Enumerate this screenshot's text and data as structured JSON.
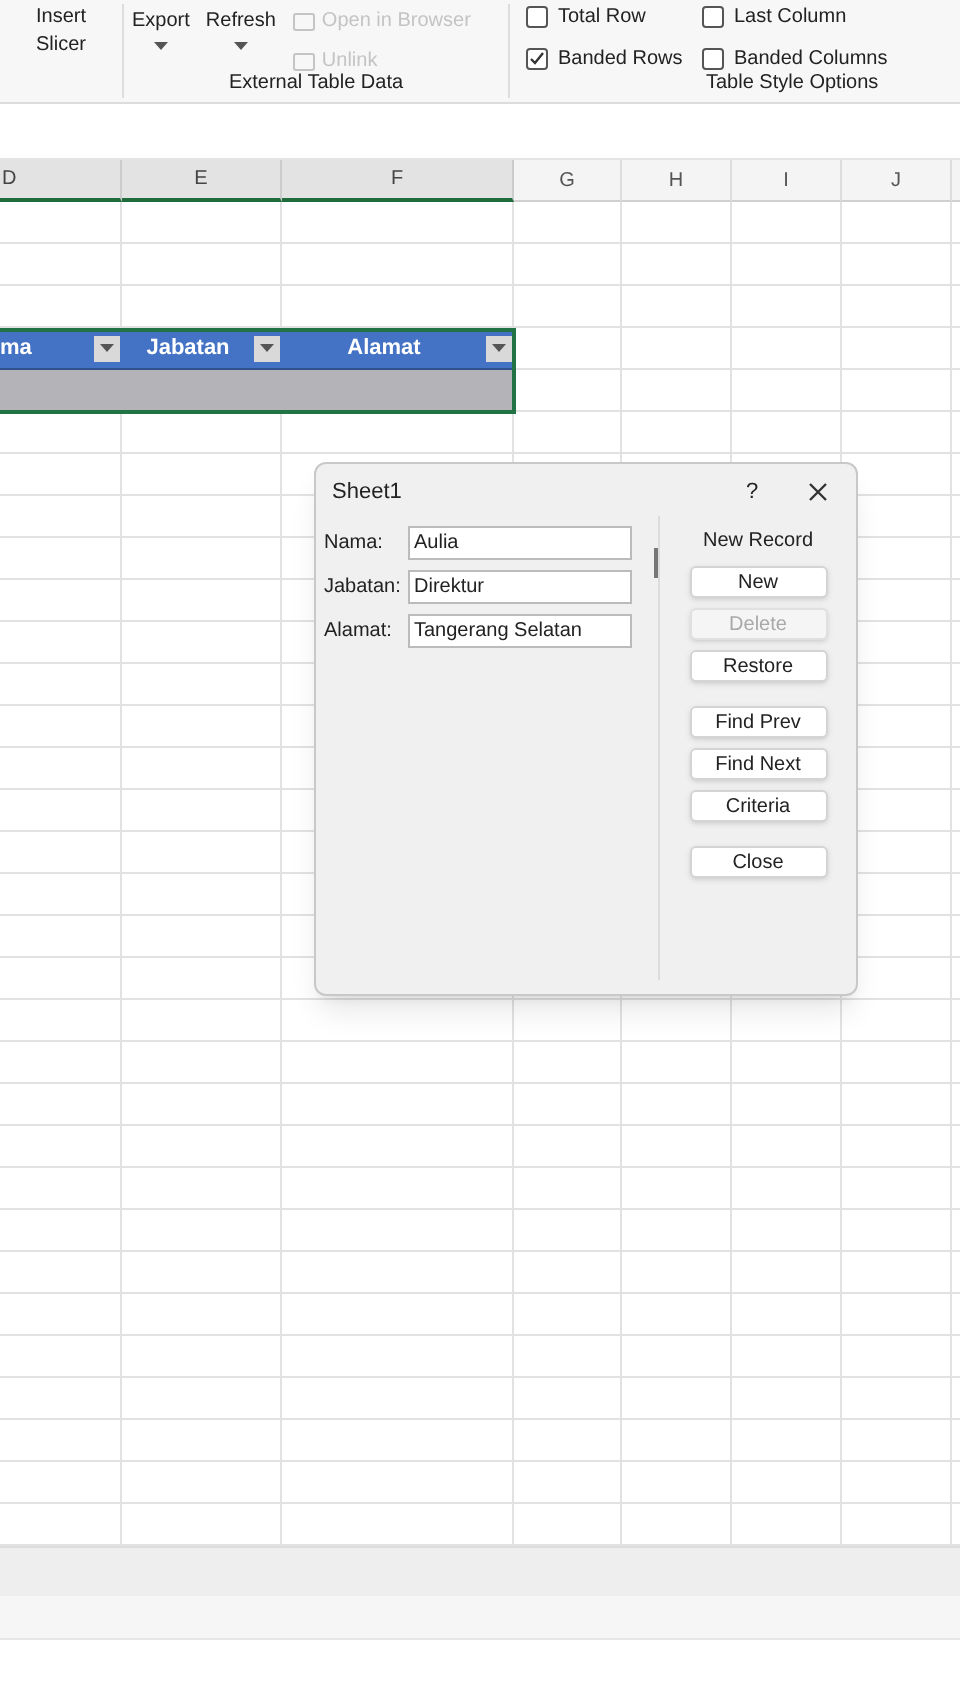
{
  "ribbon": {
    "slicer_button": {
      "label": "Insert Slicer"
    },
    "external": {
      "buttons": [
        {
          "label": "Export"
        },
        {
          "label": "Refresh"
        }
      ],
      "links": [
        {
          "label": "Open in Browser",
          "disabled": true
        },
        {
          "label": "Unlink",
          "disabled": true
        }
      ],
      "group_label": "External Table Data"
    },
    "style_options": {
      "options": [
        {
          "label": "Total Row",
          "checked": false
        },
        {
          "label": "Last Column",
          "checked": false
        },
        {
          "label": "Banded Rows",
          "checked": true
        },
        {
          "label": "Banded Columns",
          "checked": false
        }
      ],
      "group_label": "Table Style Options"
    }
  },
  "sheet": {
    "columns": [
      {
        "label": "D",
        "selected": true
      },
      {
        "label": "E",
        "selected": true
      },
      {
        "label": "F",
        "selected": true
      },
      {
        "label": "G",
        "selected": false
      },
      {
        "label": "H",
        "selected": false
      },
      {
        "label": "I",
        "selected": false
      },
      {
        "label": "J",
        "selected": false
      }
    ],
    "table_headers": [
      {
        "label": "ma"
      },
      {
        "label": "Jabatan"
      },
      {
        "label": "Alamat"
      }
    ]
  },
  "dialog": {
    "title": "Sheet1",
    "help": "?",
    "fields": [
      {
        "label": "Nama:",
        "value": "Aulia"
      },
      {
        "label": "Jabatan:",
        "value": "Direktur"
      },
      {
        "label": "Alamat:",
        "value": "Tangerang Selatan"
      }
    ],
    "record_status": "New Record",
    "buttons": [
      {
        "label": "New",
        "disabled": false
      },
      {
        "label": "Delete",
        "disabled": true
      },
      {
        "label": "Restore",
        "disabled": false
      },
      {
        "label": "Find Prev",
        "disabled": false
      },
      {
        "label": "Find Next",
        "disabled": false
      },
      {
        "label": "Criteria",
        "disabled": false
      },
      {
        "label": "Close",
        "disabled": false
      }
    ]
  }
}
